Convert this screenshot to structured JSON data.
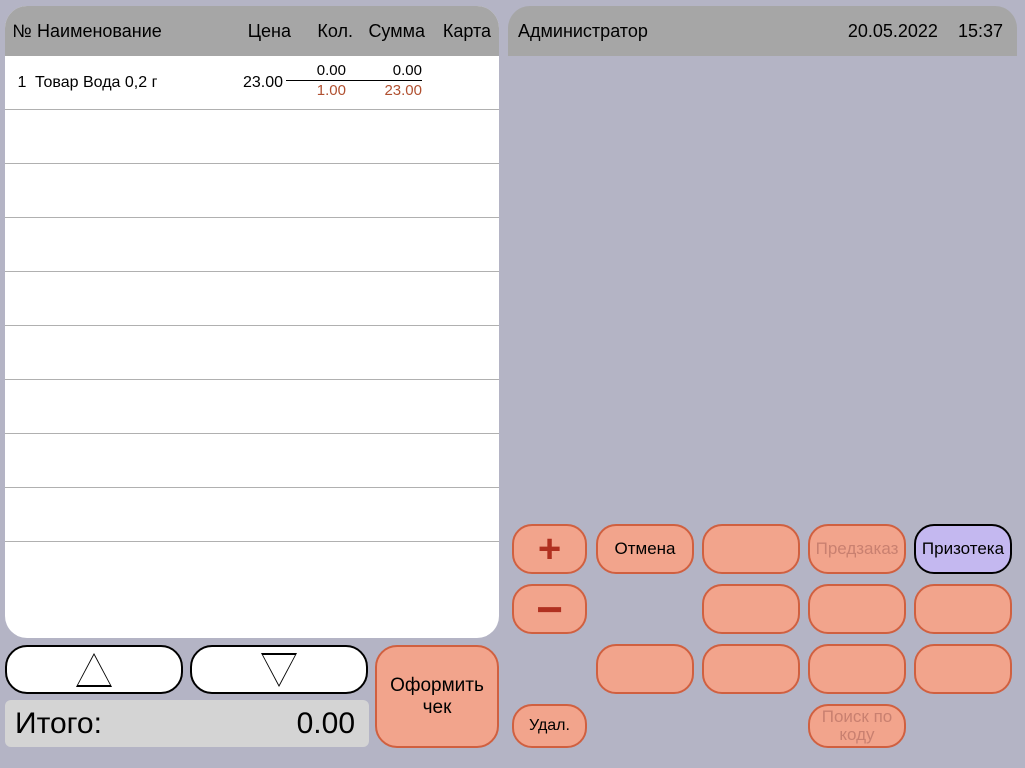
{
  "headers": {
    "num": "№",
    "name": "Наименование",
    "price": "Цена",
    "qty": "Кол.",
    "sum": "Сумма",
    "card": "Карта"
  },
  "items": [
    {
      "num": "1",
      "name": "Товар Вода 0,2 г",
      "price": "23.00",
      "qty_top": "0.00",
      "sum_top": "0.00",
      "qty_bot": "1.00",
      "sum_bot": "23.00"
    }
  ],
  "total": {
    "label": "Итого:",
    "value": "0.00"
  },
  "checkout": {
    "line1": "Оформить",
    "line2": "чек"
  },
  "right_header": {
    "user": "Администратор",
    "date": "20.05.2022",
    "time": "15:37"
  },
  "buttons": {
    "plus": "+",
    "minus": "−",
    "cancel": "Отмена",
    "preorder": "Предзаказ",
    "prizoteka": "Призотека",
    "delete": "Удал.",
    "search_line1": "Поиск по",
    "search_line2": "коду"
  }
}
